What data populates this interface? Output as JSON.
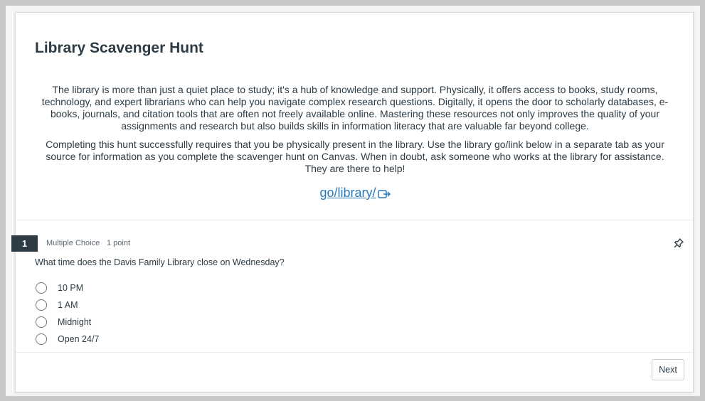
{
  "page": {
    "title": "Library Scavenger Hunt",
    "intro_paragraphs": [
      "The library is more than just a quiet place to study; it's a hub of knowledge and support. Physically, it offers access to books, study rooms, technology, and expert librarians who can help you navigate complex research questions. Digitally, it opens the door to scholarly databases, e-books, journals, and citation tools that are often not freely available online. Mastering these resources not only improves the quality of your assignments and research but also builds skills in information literacy that are valuable far beyond college.",
      "Completing this hunt successfully requires that you be physically present in the library. Use the library go/link below in a separate tab as your source for information as you complete the scavenger hunt on Canvas. When in doubt, ask someone who works at the library for assistance. They are there to help!"
    ],
    "link_text": "go/library/",
    "link_icon": "external-link-icon",
    "link_color": "#2b7abc"
  },
  "question": {
    "number": "1",
    "type": "Multiple Choice",
    "points": "1 point",
    "text": "What time does the Davis Family Library close on Wednesday?",
    "pin_icon": "pin-icon",
    "options": [
      "10 PM",
      "1 AM",
      "Midnight",
      "Open 24/7"
    ]
  },
  "footer": {
    "next_label": "Next"
  },
  "colors": {
    "badge_bg": "#2d3b45",
    "text": "#2d3b45"
  }
}
